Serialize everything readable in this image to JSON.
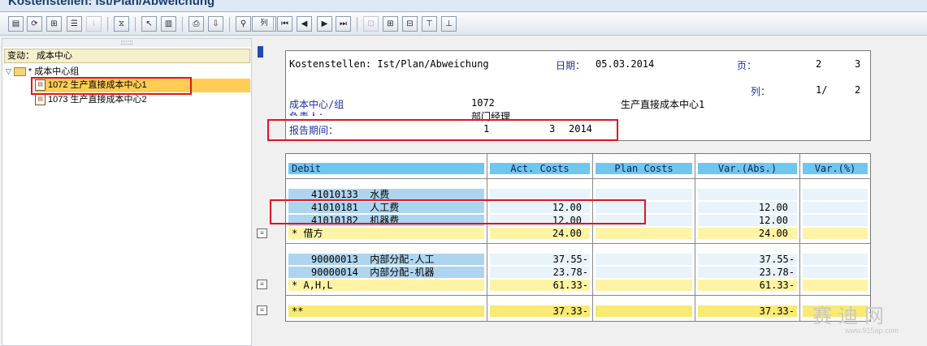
{
  "window": {
    "title": "Kostenstellen: Ist/Plan/Abweichung"
  },
  "toolbar": {
    "buttons": [
      "layout-icon",
      "refresh-icon",
      "hierarchy-icon",
      "list-icon",
      "info-icon",
      "filter-icon",
      "select-icon",
      "columns-icon",
      "print-icon",
      "export-icon",
      "binoculars-icon",
      "first-page-icon",
      "prev-page-icon",
      "next-page-icon",
      "last-page-icon",
      "expand-icon",
      "tree-icon",
      "tree-alt-icon",
      "hierarchy-down-icon",
      "hierarchy-up-icon"
    ],
    "column_btn_label": "列"
  },
  "tree": {
    "header": "变动： 成本中心",
    "group_label": "* 成本中心组",
    "items": [
      {
        "label": "1072 生产直接成本中心1",
        "selected": true
      },
      {
        "label": "1073 生产直接成本中心2",
        "selected": false
      }
    ]
  },
  "report": {
    "title": "Kostenstellen: Ist/Plan/Abweichung",
    "date_label": "日期：",
    "date_value": "05.03.2014",
    "page_label": "页：",
    "page_current": "2",
    "page_total": "3",
    "col_label": "列：",
    "col_current": "1/",
    "col_total": "2",
    "cc_label": "成本中心/组",
    "cc_value": "1072",
    "cc_name": "生产直接成本中心1",
    "resp_label": "负责人：",
    "resp_value": "部门经理",
    "period_label": "报告期间：",
    "period_from": "1",
    "period_to": "3",
    "period_year": "2014"
  },
  "table": {
    "columns": [
      "Debit",
      "Act. Costs",
      "Plan Costs",
      "Var.(Abs.)",
      "Var.(%)"
    ],
    "group1": [
      {
        "account": "41010133",
        "name": "水费",
        "act": "",
        "var": ""
      },
      {
        "account": "41010181",
        "name": "人工费",
        "act": "12.00",
        "var": "12.00"
      },
      {
        "account": "41010182",
        "name": "机器费",
        "act": "12.00",
        "var": "12.00"
      }
    ],
    "group1_total": {
      "label": "*  借方",
      "act": "24.00",
      "var": "24.00"
    },
    "group2": [
      {
        "account": "90000013",
        "name": "内部分配-人工",
        "act": "37.55-",
        "var": "37.55-"
      },
      {
        "account": "90000014",
        "name": "内部分配-机器",
        "act": "23.78-",
        "var": "23.78-"
      }
    ],
    "group2_total": {
      "label": "*  A,H,L",
      "act": "61.33-",
      "var": "61.33-"
    },
    "grand_total": {
      "label": "**",
      "act": "37.33-",
      "var": "37.33-"
    }
  },
  "watermark": {
    "text": "赛迪网",
    "url": "www.915ap.com"
  }
}
